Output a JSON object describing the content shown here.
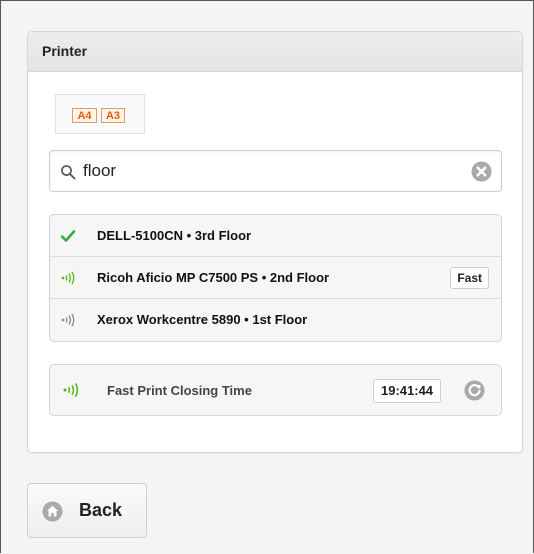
{
  "panel": {
    "title": "Printer",
    "paper_sizes": [
      "A4",
      "A3"
    ]
  },
  "search": {
    "value": "floor",
    "placeholder": ""
  },
  "printers": [
    {
      "name": "DELL-5100CN • 3rd Floor",
      "status_icon": "check-icon",
      "badge": ""
    },
    {
      "name": "Ricoh Aficio MP C7500 PS • 2nd Floor",
      "status_icon": "signal-green-icon",
      "badge": "Fast"
    },
    {
      "name": "Xerox Workcentre 5890 • 1st Floor",
      "status_icon": "signal-gray-icon",
      "badge": ""
    }
  ],
  "closing": {
    "label": "Fast Print Closing Time",
    "time": "19:41:44",
    "icon": "signal-green-icon"
  },
  "back_button": {
    "label": "Back",
    "icon": "home-icon"
  },
  "colors": {
    "accent_orange": "#e05a00",
    "check_green": "#3aa83a",
    "signal_green": "#4cbb17",
    "signal_gray": "#888888",
    "icon_gray": "#a9a9a9"
  }
}
